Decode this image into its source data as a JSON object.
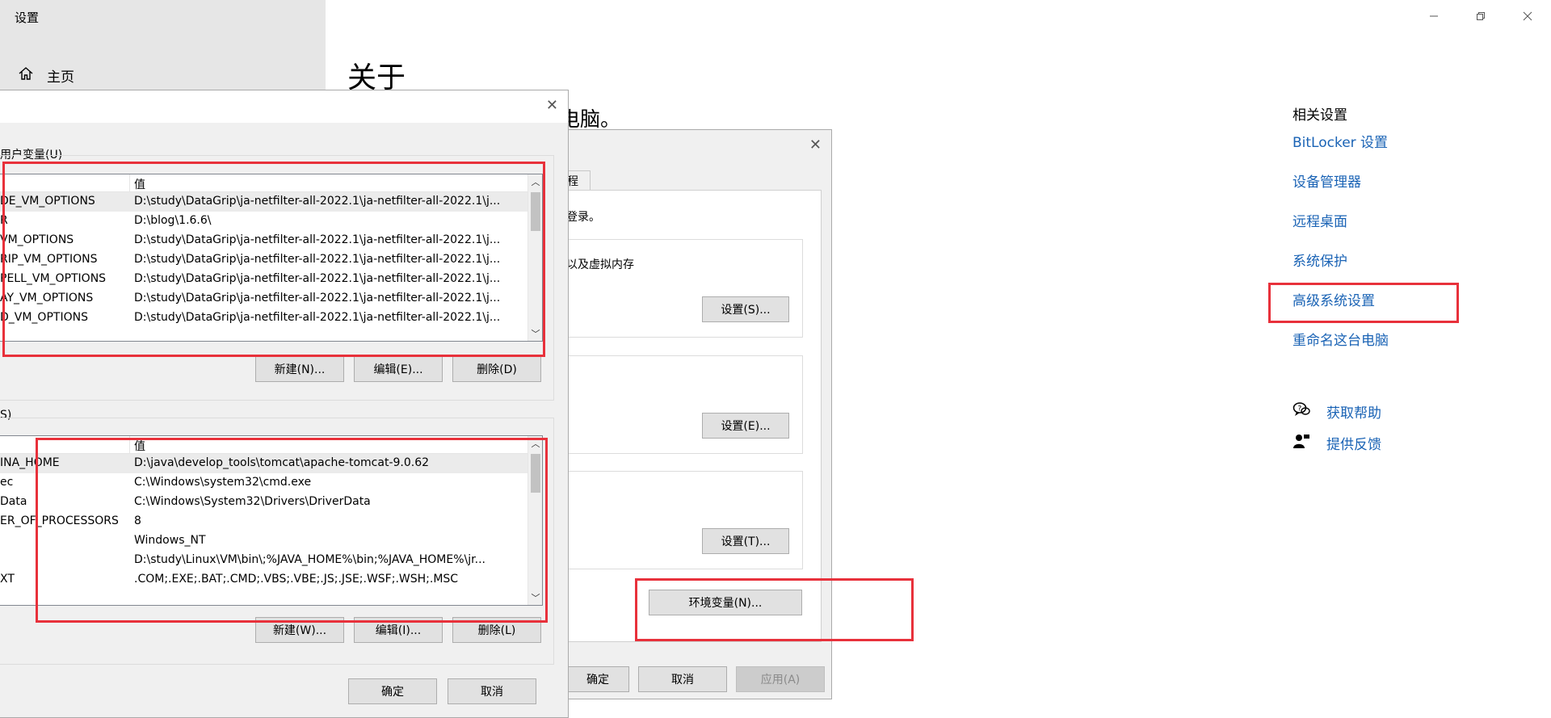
{
  "settings": {
    "window_title": "设置",
    "home_label": "主页",
    "page_title": "关于",
    "partial_heading": "电脑。",
    "related_title": "相关设置",
    "related_links": [
      "BitLocker 设置",
      "设备管理器",
      "远程桌面",
      "系统保护",
      "高级系统设置",
      "重命名这台电脑"
    ],
    "help": {
      "get_help": "获取帮助",
      "feedback": "提供反馈"
    }
  },
  "system_props": {
    "tab_partial": "程",
    "admin_note": "登录。",
    "perf_text": "以及虚拟内存",
    "btn_settings_s": "设置(S)...",
    "btn_settings_e": "设置(E)...",
    "btn_settings_t": "设置(T)...",
    "btn_env": "环境变量(N)...",
    "btn_ok": "确定",
    "btn_cancel": "取消",
    "btn_apply": "应用(A)"
  },
  "env_vars": {
    "user_section_label": "用户变量(U)",
    "system_section_label": "S)",
    "value_header": "值",
    "user_rows": [
      {
        "name": "DE_VM_OPTIONS",
        "value": "D:\\study\\DataGrip\\ja-netfilter-all-2022.1\\ja-netfilter-all-2022.1\\j..."
      },
      {
        "name": "R",
        "value": "D:\\blog\\1.6.6\\"
      },
      {
        "name": "VM_OPTIONS",
        "value": "D:\\study\\DataGrip\\ja-netfilter-all-2022.1\\ja-netfilter-all-2022.1\\j..."
      },
      {
        "name": "RIP_VM_OPTIONS",
        "value": "D:\\study\\DataGrip\\ja-netfilter-all-2022.1\\ja-netfilter-all-2022.1\\j..."
      },
      {
        "name": "PELL_VM_OPTIONS",
        "value": "D:\\study\\DataGrip\\ja-netfilter-all-2022.1\\ja-netfilter-all-2022.1\\j..."
      },
      {
        "name": "AY_VM_OPTIONS",
        "value": "D:\\study\\DataGrip\\ja-netfilter-all-2022.1\\ja-netfilter-all-2022.1\\j..."
      },
      {
        "name": "D_VM_OPTIONS",
        "value": "D:\\study\\DataGrip\\ja-netfilter-all-2022.1\\ja-netfilter-all-2022.1\\j..."
      }
    ],
    "system_rows": [
      {
        "name": "INA_HOME",
        "value": "D:\\java\\develop_tools\\tomcat\\apache-tomcat-9.0.62"
      },
      {
        "name": "ec",
        "value": "C:\\Windows\\system32\\cmd.exe"
      },
      {
        "name": "Data",
        "value": "C:\\Windows\\System32\\Drivers\\DriverData"
      },
      {
        "name": "ER_OF_PROCESSORS",
        "value": "8"
      },
      {
        "name": "",
        "value": "Windows_NT"
      },
      {
        "name": "",
        "value": "D:\\study\\Linux\\VM\\bin\\;%JAVA_HOME%\\bin;%JAVA_HOME%\\jr..."
      },
      {
        "name": "XT",
        "value": ".COM;.EXE;.BAT;.CMD;.VBS;.VBE;.JS;.JSE;.WSF;.WSH;.MSC"
      }
    ],
    "btn_user_new": "新建(N)...",
    "btn_user_edit": "编辑(E)...",
    "btn_user_delete": "删除(D)",
    "btn_sys_new": "新建(W)...",
    "btn_sys_edit": "编辑(I)...",
    "btn_sys_delete": "删除(L)",
    "btn_ok": "确定",
    "btn_cancel": "取消"
  },
  "colors": {
    "link": "#1a63b5",
    "highlight_box": "#e8313b"
  }
}
